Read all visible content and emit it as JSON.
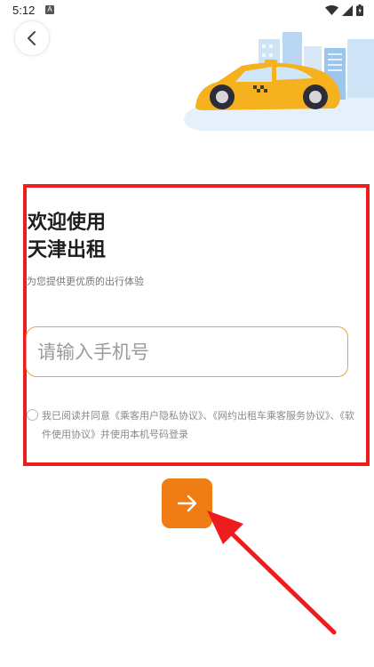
{
  "status_bar": {
    "time": "5:12",
    "notification_letter": "A"
  },
  "welcome": {
    "line1": "欢迎使用",
    "line2": "天津出租"
  },
  "subtitle": "为您提供更优质的出行体验",
  "phone_input": {
    "placeholder": "请输入手机号",
    "value": ""
  },
  "agreement": {
    "prefix": "我已阅读并同意",
    "privacy_link": "《乘客用户隐私协议》",
    "sep": "、",
    "service_link": "《网约出租车乘客服务协议》",
    "sep2": "、",
    "software_link": "《软件使用协议》",
    "suffix": "并使用本机号码登录",
    "checked": false
  },
  "colors": {
    "accent": "#f07d14",
    "input_border": "#e9a33c",
    "annotation": "#ee1c1c",
    "taxi": "#f5b21e"
  },
  "icons": {
    "back": "chevron-left-icon",
    "next": "arrow-right-icon"
  }
}
